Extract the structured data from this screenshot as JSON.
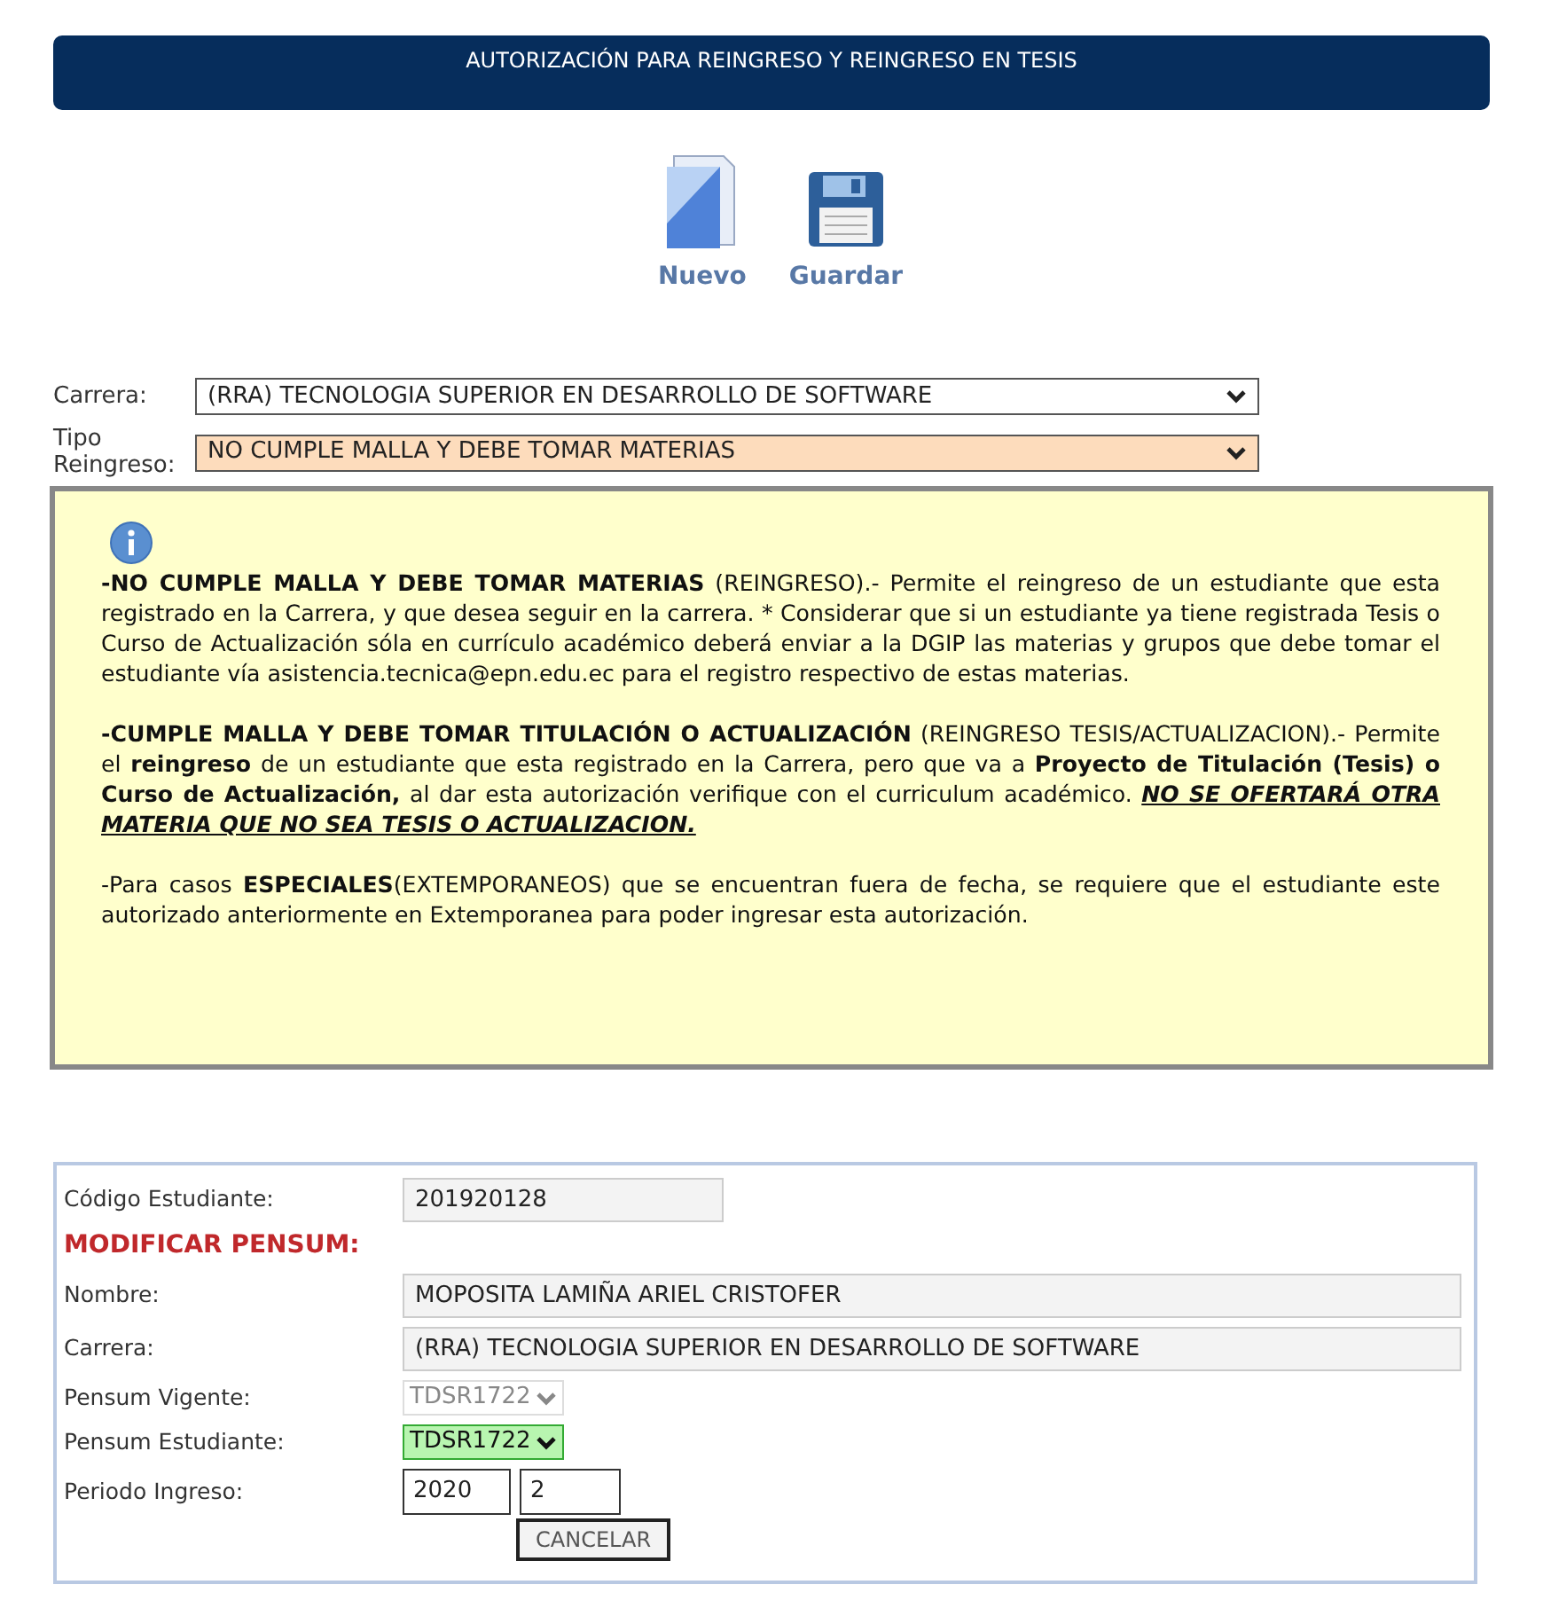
{
  "header": {
    "title": "AUTORIZACIÓN PARA REINGRESO Y REINGRESO EN TESIS"
  },
  "toolbar": [
    {
      "label": "Nuevo",
      "kind": "new"
    },
    {
      "label": "Guardar",
      "kind": "save"
    }
  ],
  "selects": [
    {
      "label": "Carrera:",
      "value": "(RRA) TECNOLOGIA SUPERIOR EN DESARROLLO DE SOFTWARE",
      "highlighted": false
    },
    {
      "label": "Tipo Reingreso:",
      "value": "NO CUMPLE MALLA Y DEBE TOMAR MATERIAS",
      "highlighted": true
    }
  ],
  "info": {
    "paragraphs": [
      "**-NO CUMPLE MALLA Y DEBE TOMAR MATERIAS** (REINGRESO).- Permite el reingreso de un estudiante que esta registrado en la Carrera, y que desea seguir en la  carrera. * Considerar que si un estudiante ya tiene registrada Tesis o Curso de Actualización sóla en currículo académico deberá enviar a la DGIP las materias y grupos que debe tomar el estudiante vía asistencia.tecnica@epn.edu.ec para el registro respectivo de estas materias.",
      "**-CUMPLE MALLA Y DEBE TOMAR TITULACIÓN O ACTUALIZACIÓN** (REINGRESO TESIS/ACTUALIZACION).- Permite el **reingreso** de un estudiante que esta registrado en la Carrera, pero que va a **Proyecto de Titulación (Tesis) o Curso de Actualización,** al dar esta autorización verifique con el curriculum académico. ",
      "NO SE OFERTARÁ OTRA MATERIA QUE NO SEA TESIS O ACTUALIZACION.",
      "-Para casos **ESPECIALES**(EXTEMPORANEOS)  que se encuentran fuera de fecha,  se requiere que el estudiante este autorizado anteriormente en Extemporanea para poder ingresar esta autorización."
    ]
  },
  "student_form": {
    "rows": [
      {
        "kind": "text",
        "label": "Código Estudiante:",
        "value": "201920128"
      },
      {
        "kind": "heading",
        "text": "MODIFICAR PENSUM:"
      },
      {
        "kind": "wide",
        "label": "Nombre:",
        "value": "MOPOSITA LAMIÑA ARIEL CRISTOFER"
      },
      {
        "kind": "wide",
        "label": "Carrera:",
        "value": "(RRA) TECNOLOGIA SUPERIOR EN DESARROLLO DE SOFTWARE"
      },
      {
        "kind": "select",
        "label": "Pensum Vigente:",
        "value": "TDSR1722",
        "disabled": true,
        "highlighted": false
      },
      {
        "kind": "select",
        "label": "Pensum Estudiante:",
        "value": "TDSR1722",
        "disabled": false,
        "highlighted": true
      },
      {
        "kind": "pair",
        "label": "Periodo Ingreso:",
        "values": [
          "2020",
          "2"
        ]
      }
    ],
    "button": "CANCELAR"
  }
}
